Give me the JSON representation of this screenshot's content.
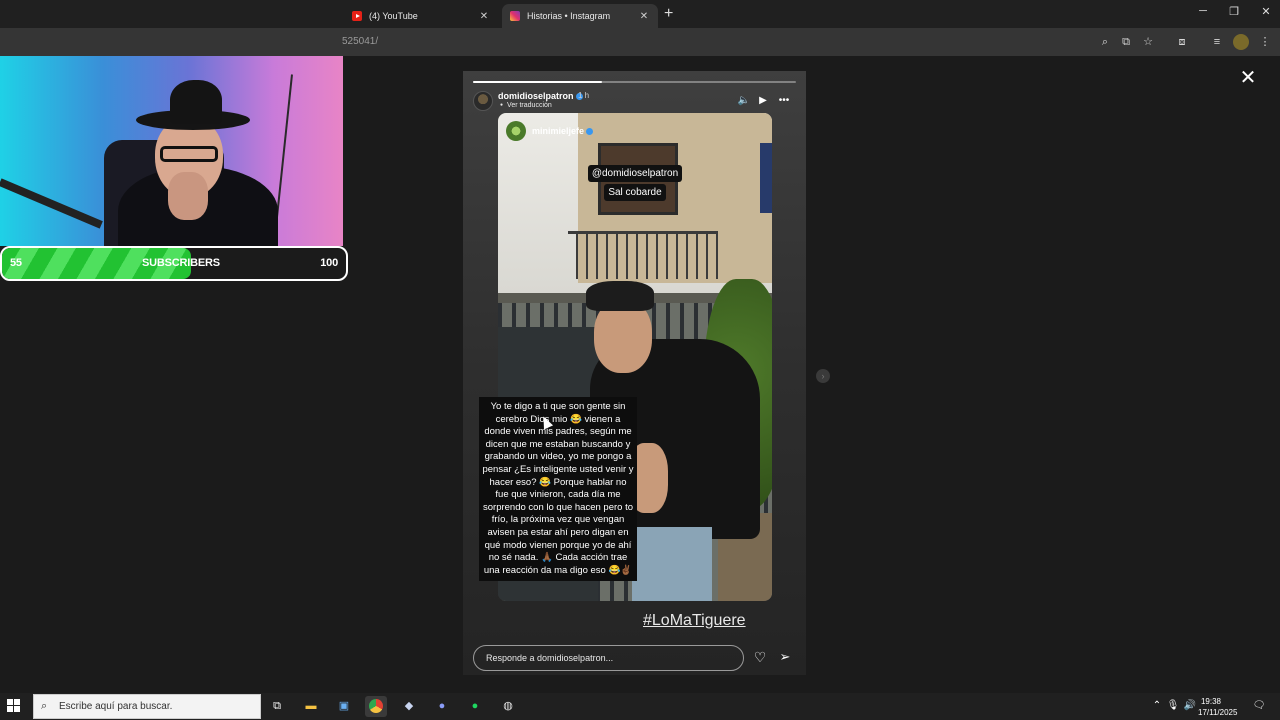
{
  "browser": {
    "tabs": [
      {
        "title": "(4) YouTube",
        "favicon": "youtube-favicon"
      },
      {
        "title": "Historias • Instagram",
        "favicon": "instagram-favicon"
      }
    ],
    "new_tab": "+",
    "url": "525041/",
    "window_controls": {
      "minimize": "─",
      "restore": "❐",
      "close": "✕"
    }
  },
  "overlay": {
    "sub_goal": {
      "current": "55",
      "label": "SUBSCRIBERS",
      "target": "100",
      "progress_fraction": 0.55
    }
  },
  "story": {
    "username": "domidioselpatron",
    "time": "1 h",
    "translate": "Ver traducción",
    "progress_fraction": 0.4,
    "inner_user": "minimieljefe",
    "mention_line1": "@domidioselpatron",
    "mention_line2": "Sal cobarde",
    "caption": "Yo te digo a ti que son gente sin cerebro Dios mio 😂 vienen a donde viven mis padres, según me dicen que me estaban buscando y grabando un video, yo me pongo a pensar ¿Es inteligente usted venir y hacer eso? 😂 Porque hablar no fue que vinieron, cada día me sorprendo con lo que hacen pero to frío, la próxima vez que vengan avisen pa estar ahí pero digan en qué modo vienen porque yo de ahí no sé nada. 🙏🏾 Cada acción trae una reacción da ma digo eso 😂✌🏾",
    "hashtag": "#LoMaTiguere",
    "reply_placeholder": "Responde a domidioselpatron..."
  },
  "taskbar": {
    "search_placeholder": "Escribe aquí para buscar.",
    "time": "19:38",
    "date": "17/11/2025"
  }
}
